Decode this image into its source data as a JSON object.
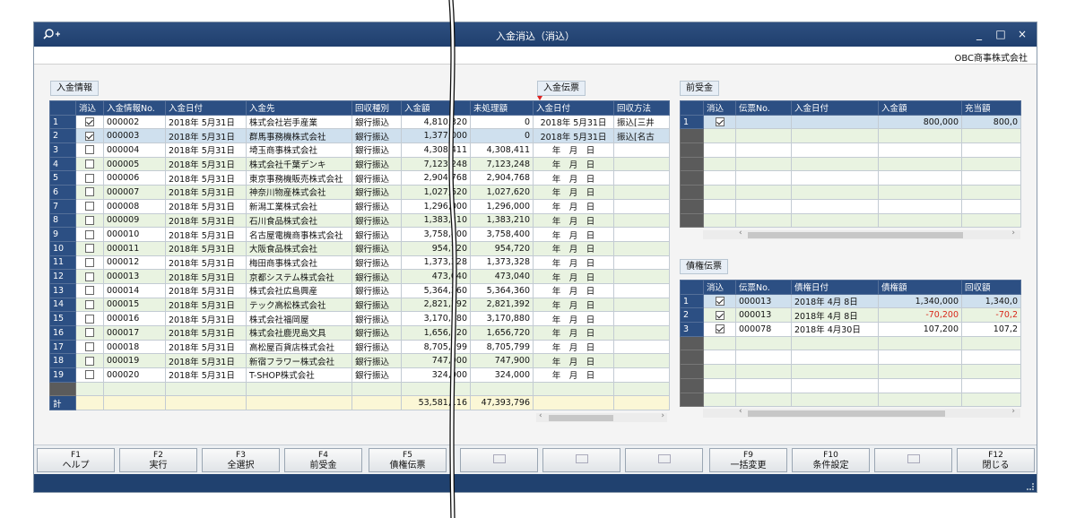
{
  "window": {
    "title": "入金消込（消込）",
    "company": "OBC商事株式会社",
    "minimize": "_",
    "maximize": "□",
    "close": "×"
  },
  "sections": {
    "payment_info": "入金情報",
    "payment_slip": "入金伝票",
    "advance": "前受金",
    "receivable": "債権伝票"
  },
  "main_table": {
    "headers": [
      "",
      "消込",
      "入金情報No.",
      "入金日付",
      "入金先",
      "回収種別",
      "入金額",
      "未処理額",
      "入金日付",
      "回収方法"
    ],
    "rows": [
      {
        "n": "1",
        "checked": true,
        "no": "000002",
        "date": "2018年 5月31日",
        "payer": "株式会社岩手産業",
        "type": "銀行振込",
        "amount": "4,810,320",
        "unproc": "0",
        "pdate": "2018年 5月31日",
        "method": "振込[三井"
      },
      {
        "n": "2",
        "checked": true,
        "no": "000003",
        "date": "2018年 5月31日",
        "payer": "群馬事務機株式会社",
        "type": "銀行振込",
        "amount": "1,377,000",
        "unproc": "0",
        "pdate": "2018年 5月31日",
        "method": "振込[名古"
      },
      {
        "n": "3",
        "checked": false,
        "no": "000004",
        "date": "2018年 5月31日",
        "payer": "埼玉商事株式会社",
        "type": "銀行振込",
        "amount": "4,308,411",
        "unproc": "4,308,411",
        "pdate": "年　月　日",
        "method": ""
      },
      {
        "n": "4",
        "checked": false,
        "no": "000005",
        "date": "2018年 5月31日",
        "payer": "株式会社千葉デンキ",
        "type": "銀行振込",
        "amount": "7,123,248",
        "unproc": "7,123,248",
        "pdate": "年　月　日",
        "method": ""
      },
      {
        "n": "5",
        "checked": false,
        "no": "000006",
        "date": "2018年 5月31日",
        "payer": "東京事務機販売株式会社",
        "type": "銀行振込",
        "amount": "2,904,768",
        "unproc": "2,904,768",
        "pdate": "年　月　日",
        "method": ""
      },
      {
        "n": "6",
        "checked": false,
        "no": "000007",
        "date": "2018年 5月31日",
        "payer": "神奈川物産株式会社",
        "type": "銀行振込",
        "amount": "1,027,620",
        "unproc": "1,027,620",
        "pdate": "年　月　日",
        "method": ""
      },
      {
        "n": "7",
        "checked": false,
        "no": "000008",
        "date": "2018年 5月31日",
        "payer": "新潟工業株式会社",
        "type": "銀行振込",
        "amount": "1,296,000",
        "unproc": "1,296,000",
        "pdate": "年　月　日",
        "method": ""
      },
      {
        "n": "8",
        "checked": false,
        "no": "000009",
        "date": "2018年 5月31日",
        "payer": "石川食品株式会社",
        "type": "銀行振込",
        "amount": "1,383,210",
        "unproc": "1,383,210",
        "pdate": "年　月　日",
        "method": ""
      },
      {
        "n": "9",
        "checked": false,
        "no": "000010",
        "date": "2018年 5月31日",
        "payer": "名古屋電機商事株式会社",
        "type": "銀行振込",
        "amount": "3,758,400",
        "unproc": "3,758,400",
        "pdate": "年　月　日",
        "method": ""
      },
      {
        "n": "10",
        "checked": false,
        "no": "000011",
        "date": "2018年 5月31日",
        "payer": "大阪食品株式会社",
        "type": "銀行振込",
        "amount": "954,720",
        "unproc": "954,720",
        "pdate": "年　月　日",
        "method": ""
      },
      {
        "n": "11",
        "checked": false,
        "no": "000012",
        "date": "2018年 5月31日",
        "payer": "梅田商事株式会社",
        "type": "銀行振込",
        "amount": "1,373,328",
        "unproc": "1,373,328",
        "pdate": "年　月　日",
        "method": ""
      },
      {
        "n": "12",
        "checked": false,
        "no": "000013",
        "date": "2018年 5月31日",
        "payer": "京都システム株式会社",
        "type": "銀行振込",
        "amount": "473,040",
        "unproc": "473,040",
        "pdate": "年　月　日",
        "method": ""
      },
      {
        "n": "13",
        "checked": false,
        "no": "000014",
        "date": "2018年 5月31日",
        "payer": "株式会社広島興産",
        "type": "銀行振込",
        "amount": "5,364,360",
        "unproc": "5,364,360",
        "pdate": "年　月　日",
        "method": ""
      },
      {
        "n": "14",
        "checked": false,
        "no": "000015",
        "date": "2018年 5月31日",
        "payer": "テック高松株式会社",
        "type": "銀行振込",
        "amount": "2,821,392",
        "unproc": "2,821,392",
        "pdate": "年　月　日",
        "method": ""
      },
      {
        "n": "15",
        "checked": false,
        "no": "000016",
        "date": "2018年 5月31日",
        "payer": "株式会社福岡屋",
        "type": "銀行振込",
        "amount": "3,170,880",
        "unproc": "3,170,880",
        "pdate": "年　月　日",
        "method": ""
      },
      {
        "n": "16",
        "checked": false,
        "no": "000017",
        "date": "2018年 5月31日",
        "payer": "株式会社鹿児島文具",
        "type": "銀行振込",
        "amount": "1,656,720",
        "unproc": "1,656,720",
        "pdate": "年　月　日",
        "method": ""
      },
      {
        "n": "17",
        "checked": false,
        "no": "000018",
        "date": "2018年 5月31日",
        "payer": "高松屋百貨店株式会社",
        "type": "銀行振込",
        "amount": "8,705,799",
        "unproc": "8,705,799",
        "pdate": "年　月　日",
        "method": ""
      },
      {
        "n": "18",
        "checked": false,
        "no": "000019",
        "date": "2018年 5月31日",
        "payer": "新宿フラワー株式会社",
        "type": "銀行振込",
        "amount": "747,900",
        "unproc": "747,900",
        "pdate": "年　月　日",
        "method": ""
      },
      {
        "n": "19",
        "checked": false,
        "no": "000020",
        "date": "2018年 5月31日",
        "payer": "T-SHOP株式会社",
        "type": "銀行振込",
        "amount": "324,000",
        "unproc": "324,000",
        "pdate": "年　月　日",
        "method": ""
      }
    ],
    "total_label": "計",
    "total_amount": "53,581,116",
    "total_unproc": "47,393,796"
  },
  "advance_table": {
    "headers": [
      "",
      "消込",
      "伝票No.",
      "入金日付",
      "入金額",
      "充当額"
    ],
    "rows": [
      {
        "n": "1",
        "checked": true,
        "no": "",
        "date": "",
        "amount": "800,000",
        "applied": "800,0"
      }
    ]
  },
  "receivable_table": {
    "headers": [
      "",
      "消込",
      "伝票No.",
      "債権日付",
      "債権額",
      "回収額"
    ],
    "rows": [
      {
        "n": "1",
        "checked": true,
        "no": "000013",
        "date": "2018年 4月 8日",
        "amount": "1,340,000",
        "collected": "1,340,0",
        "neg": false
      },
      {
        "n": "2",
        "checked": true,
        "no": "000013",
        "date": "2018年 4月 8日",
        "amount": "-70,200",
        "collected": "-70,2",
        "neg": true
      },
      {
        "n": "3",
        "checked": true,
        "no": "000078",
        "date": "2018年 4月30日",
        "amount": "107,200",
        "collected": "107,2",
        "neg": false
      }
    ]
  },
  "fkeys": [
    {
      "key": "F1",
      "label": "ヘルプ"
    },
    {
      "key": "F2",
      "label": "実行"
    },
    {
      "key": "F3",
      "label": "全選択"
    },
    {
      "key": "F4",
      "label": "前受金"
    },
    {
      "key": "F5",
      "label": "債権伝票"
    },
    {
      "key": "",
      "label": ""
    },
    {
      "key": "",
      "label": ""
    },
    {
      "key": "",
      "label": ""
    },
    {
      "key": "F9",
      "label": "一括変更"
    },
    {
      "key": "F10",
      "label": "条件設定"
    },
    {
      "key": "",
      "label": ""
    },
    {
      "key": "F12",
      "label": "閉じる"
    }
  ],
  "colors": {
    "header": "#2c4f83",
    "title": "#1f3f6e",
    "even_row": "#e9f3e1",
    "selected_row": "#cfe0ee",
    "negative": "#d8281a"
  }
}
